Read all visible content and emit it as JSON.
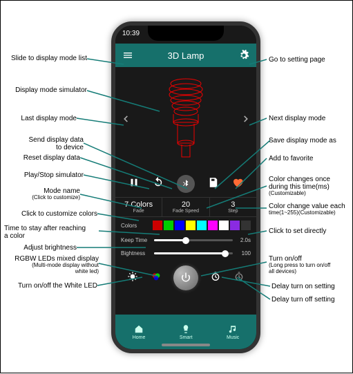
{
  "status": {
    "time": "10:39"
  },
  "topbar": {
    "title": "3D Lamp"
  },
  "modes": [
    {
      "value": "7 Colors",
      "label": "Fade"
    },
    {
      "value": "20",
      "label": "Fade Speed"
    },
    {
      "value": "3",
      "label": "Step"
    }
  ],
  "rows": {
    "colors": {
      "label": "Colors"
    },
    "keep": {
      "label": "Keep Time",
      "value": "2.0s"
    },
    "bright": {
      "label": "Bightness",
      "value": "100"
    }
  },
  "swatches": [
    "#c00",
    "#0c0",
    "#00f",
    "#ff0",
    "#0ff",
    "#f0f",
    "#fff",
    "#8a2be2",
    "#333"
  ],
  "tabs": [
    {
      "label": "Home"
    },
    {
      "label": "Smart"
    },
    {
      "label": "Music"
    }
  ],
  "callouts": {
    "l1": "Slide to display mode list",
    "l2": "Display mode simulator",
    "l3": "Last display mode",
    "l4a": "Send display data",
    "l4b": "to device",
    "l5": "Reset display data",
    "l6": "Play/Stop simulator",
    "l7a": "Mode name",
    "l7b": "(Click to customize)",
    "l8": "Click to customize colors",
    "l9a": "Time to stay after reaching",
    "l9b": "a color",
    "l10": "Adjust brightness",
    "l11a": "RGBW LEDs mixed display",
    "l11b": "(Multi-mode display without",
    "l11c": "white led)",
    "l12": "Turn on/off  the White LED",
    "r1": "Go to setting page",
    "r2": "Next display mode",
    "r3": "Save  display mode as",
    "r4": "Add to favorite",
    "r5a": "Color changes once",
    "r5b": "during this time(ms)",
    "r5c": "(Customizable)",
    "r6a": "Color change value each",
    "r6b": "time(1~255)(Customizable)",
    "r7": "Click to set directly",
    "r8a": "Turn on/off",
    "r8b": "(Long press to turn on/off",
    "r8c": " all  devices)",
    "r9": "Delay turn on setting",
    "r10": "Delay turn off setting"
  }
}
